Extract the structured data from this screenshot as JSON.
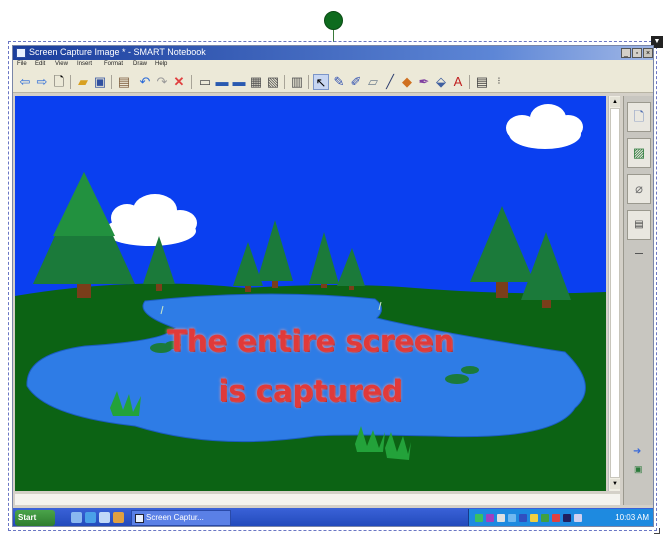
{
  "window": {
    "title": "Screen Capture Image * - SMART Notebook",
    "minimize": "_",
    "restore": "▫",
    "close": "×"
  },
  "menu": [
    "File",
    "Edit",
    "View",
    "Insert",
    "Format",
    "Draw",
    "Help"
  ],
  "toolbar_icons": [
    "back-arrow-icon",
    "forward-arrow-icon",
    "new-page-icon",
    "open-folder-icon",
    "save-icon",
    "paste-icon",
    "undo-icon",
    "redo-icon",
    "delete-icon",
    "screen-shade-icon",
    "show-screen-icon",
    "full-screen-icon",
    "capture-icon",
    "page-sort-icon",
    "table-icon",
    "select-arrow-icon",
    "pen-icon",
    "creative-pen-icon",
    "eraser-icon",
    "line-icon",
    "shape-icon",
    "magic-pen-icon",
    "fill-icon",
    "text-icon",
    "properties-icon",
    "more-icon"
  ],
  "canvas": {
    "line1": "The entire screen",
    "line2": "is captured"
  },
  "sidebar_tabs": [
    "page-sorter-icon",
    "gallery-icon",
    "attachments-icon",
    "properties-tab-icon"
  ],
  "taskbar": {
    "start_label": "Start",
    "task_label": "Screen Captur...",
    "clock": "10:03 AM"
  },
  "colors": {
    "sky": "#0a3ff0",
    "grass": "#0c6314",
    "lake": "#2e7ce6",
    "tree": "#1b7a3a",
    "headline": "#e03a3a"
  }
}
